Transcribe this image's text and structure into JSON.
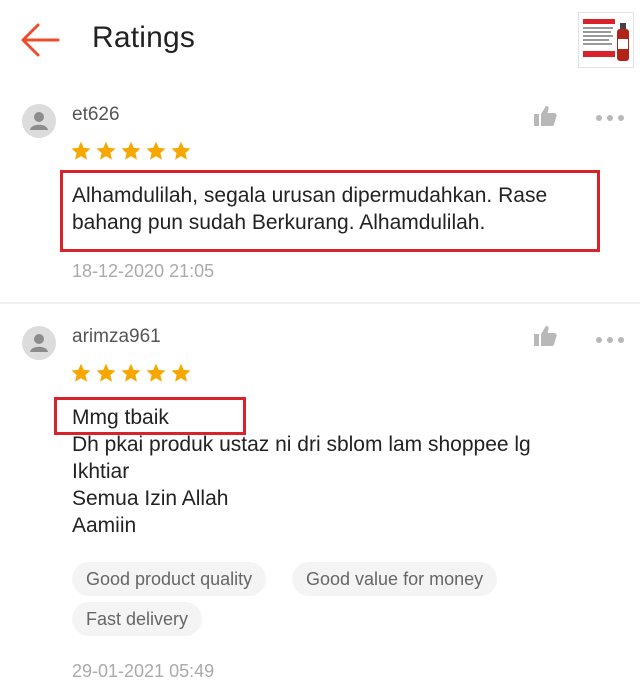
{
  "header": {
    "title": "Ratings",
    "accent_color": "#ee4d2d"
  },
  "reviews": [
    {
      "username": "et626",
      "rating": 5,
      "comment": "Alhamdulilah, segala urusan dipermudahkan. Rase bahang pun sudah Berkurang. Alhamdulilah.",
      "timestamp": "18-12-2020 21:05"
    },
    {
      "username": "arimza961",
      "rating": 5,
      "comment": "Mmg tbaik\nDh pkai produk ustaz ni dri sblom lam shoppee lg\nIkhtiar\nSemua Izin Allah\nAamiin",
      "tags": [
        "Good product quality",
        "Good value for money",
        "Fast delivery"
      ],
      "timestamp": "29-01-2021 05:49"
    }
  ],
  "colors": {
    "star": "#f6a700",
    "highlight": "#d8232a",
    "muted": "#aaaaaa"
  },
  "icons": {
    "back": "arrow-left-icon",
    "like": "thumbs-up-icon",
    "more": "more-horizontal-icon",
    "avatar": "user-avatar-icon",
    "star": "star-icon"
  }
}
